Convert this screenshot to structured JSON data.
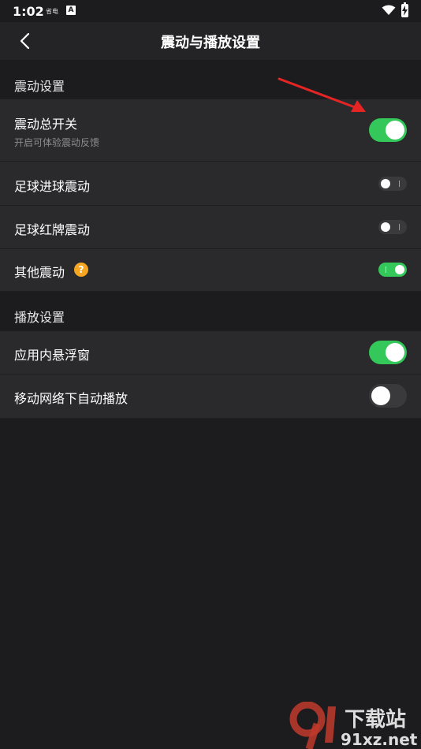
{
  "status_bar": {
    "time": "1:02",
    "mini_icon": "省电",
    "a_icon": "A"
  },
  "header": {
    "title": "震动与播放设置"
  },
  "sections": [
    {
      "title": "震动设置",
      "rows": [
        {
          "label": "震动总开关",
          "subtitle": "开启可体验震动反馈",
          "toggle_on": true
        },
        {
          "label": "足球进球震动",
          "toggle_on": false
        },
        {
          "label": "足球红牌震动",
          "toggle_on": false
        },
        {
          "label": "其他震动",
          "help_icon": "?",
          "toggle_on": true
        }
      ]
    },
    {
      "title": "播放设置",
      "rows": [
        {
          "label": "应用内悬浮窗",
          "toggle_on": true
        },
        {
          "label": "移动网络下自动播放",
          "toggle_on": false
        }
      ]
    }
  ],
  "watermark": {
    "line1": "下载站",
    "line2": "91xz.net"
  },
  "colors": {
    "toggle_on": "#34c759",
    "toggle_off": "#3a3a3c",
    "help": "#f5a623",
    "arrow": "#e52424"
  }
}
